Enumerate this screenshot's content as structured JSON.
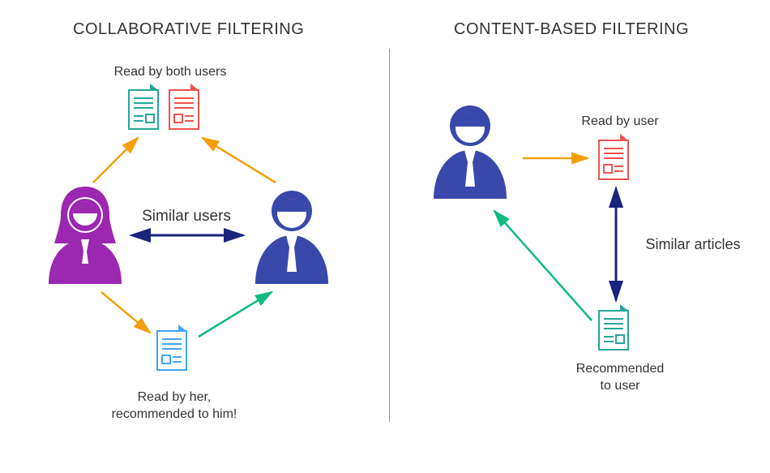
{
  "left": {
    "title": "COLLABORATIVE FILTERING",
    "topLabel": "Read by both users",
    "middleLabel": "Similar users",
    "bottomLabel": "Read by her,\nrecommended to him!"
  },
  "right": {
    "title": "CONTENT-BASED FILTERING",
    "topLabel": "Read by user",
    "middleLabel": "Similar articles",
    "bottomLabel": "Recommended\nto user"
  },
  "colors": {
    "purple": "#9c27b0",
    "blue": "#3949ab",
    "navy": "#1a237e",
    "orange": "#f59e0b",
    "green": "#10b981",
    "teal": "#26a69a",
    "red": "#ef5350",
    "skyblue": "#42a5f5"
  }
}
